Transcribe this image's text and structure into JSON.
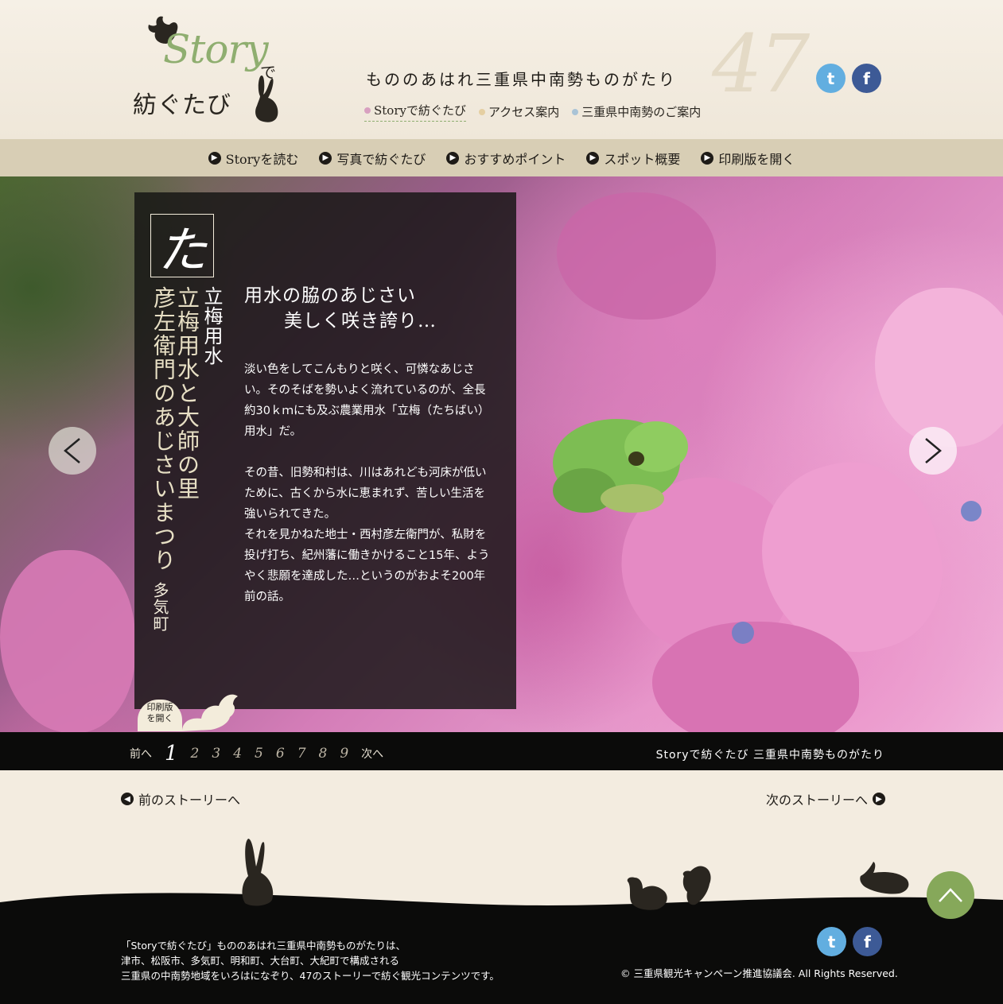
{
  "header": {
    "logo_story": "Story",
    "logo_de": "で",
    "logo_sub": "紡ぐたび",
    "tagline": "もののあはれ三重県中南勢ものがたり",
    "big_number": "47",
    "nav": [
      {
        "label": "Storyで紡ぐたび",
        "color": "#d8a0c0"
      },
      {
        "label": "アクセス案内",
        "color": "#e5cfa2"
      },
      {
        "label": "三重県中南勢のご案内",
        "color": "#a9c3d6"
      }
    ],
    "twitter_icon": "t",
    "facebook_icon": "f"
  },
  "menu": [
    {
      "label": "Storyを読む"
    },
    {
      "label": "写真で紡ぐたび"
    },
    {
      "label": "おすすめポイント"
    },
    {
      "label": "スポット概要"
    },
    {
      "label": "印刷版を開く"
    }
  ],
  "story": {
    "kana": "た",
    "subtitle_vertical": "立梅用水",
    "main_vertical_1": "立梅用水と大師の里",
    "main_vertical_2": "彦左衛門のあじさいまつり",
    "town": "多気町",
    "title_line1": "用水の脇のあじさい",
    "title_line2": "美しく咲き誇り…",
    "body_p1": "淡い色をしてこんもりと咲く、可憐なあじさい。そのそばを勢いよく流れているのが、全長約30ｋｍにも及ぶ農業用水「立梅（たちばい）用水」だ。",
    "body_p2": "その昔、旧勢和村は、川はあれども河床が低いために、古くから水に恵まれず、苦しい生活を強いられてきた。",
    "body_p3": "それを見かねた地士・西村彦左衛門が、私財を投げ打ち、紀州藩に働きかけること15年、ようやく悲願を達成した…というのがおよそ200年前の話。",
    "print_label_1": "印刷版",
    "print_label_2": "を開く"
  },
  "pager": {
    "prev": "前へ",
    "next": "次へ",
    "pages": [
      "1",
      "2",
      "3",
      "4",
      "5",
      "6",
      "7",
      "8",
      "9"
    ],
    "current": "1",
    "title": "Storyで紡ぐたび 三重県中南勢ものがたり"
  },
  "story_nav": {
    "prev": "前のストーリーへ",
    "next": "次のストーリーへ"
  },
  "footer": {
    "line1": "「Storyで紡ぐたび」もののあはれ三重県中南勢ものがたりは、",
    "line2": "津市、松阪市、多気町、明和町、大台町、大紀町で構成される",
    "line3": "三重県の中南勢地域をいろはになぞり、47のストーリーで紡ぐ観光コンテンツです。",
    "copyright": "© 三重県観光キャンペーン推進協議会. All Rights Reserved."
  },
  "colors": {
    "accent_green": "#86a85a",
    "menu_bg": "#d8ceb5",
    "twitter": "#62aee0",
    "facebook": "#3d5a96"
  }
}
